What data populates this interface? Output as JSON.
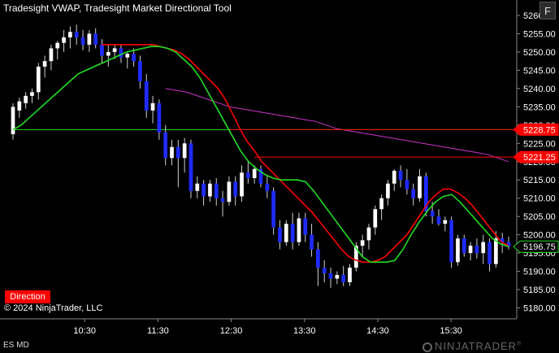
{
  "indicator_title": "Tradesight VWAP, Tradesight Market Directional Tool",
  "panel_button": "F",
  "direction_label": "Direction",
  "copyright": "© 2024 NinjaTrader, LLC",
  "instrument": "ES MD",
  "logo": "NINJATRADER",
  "logo_mark": "®",
  "colors": {
    "background": "#000000",
    "up_candle": "#ffffff",
    "down_candle": "#1f2bff",
    "red_line": "#ff0000",
    "green_line": "#22dd22",
    "vwap": "#cc33cc"
  },
  "chart_data": {
    "type": "candlestick",
    "title": "",
    "y_axis_ticks": [
      5260,
      5255,
      5250,
      5245,
      5240,
      5235,
      5230,
      5225,
      5220,
      5215,
      5210,
      5205,
      5200,
      5195,
      5190,
      5185,
      5180
    ],
    "y_axis_tick_labels": [
      "5260.00",
      "5255.00",
      "5250.00",
      "5245.00",
      "5240.00",
      "5235.00",
      "5230.00",
      "5225.00",
      "5220.00",
      "5215.00",
      "5210.00",
      "5205.00",
      "5200.00",
      "5195.00",
      "5190.00",
      "5185.00",
      "5180.00"
    ],
    "x_axis_ticks": [
      "10:30",
      "11:30",
      "12:30",
      "13:30",
      "14:30",
      "15:30"
    ],
    "ylim": [
      5177,
      5262
    ],
    "price_labels": [
      {
        "value": 5228.75,
        "label": "5228.75",
        "style": "red"
      },
      {
        "value": 5221.25,
        "label": "5221.25",
        "style": "red"
      },
      {
        "value": 5196.75,
        "label": "5196.75",
        "style": "green"
      }
    ],
    "horizontal_levels": [
      {
        "color": "#ff0000",
        "value": 5228.75
      },
      {
        "color": "#ff0000",
        "value": 5221.25
      },
      {
        "color": "#22dd22",
        "value": 5228.75
      }
    ],
    "candles": [
      {
        "o": 5227.5,
        "h": 5236.0,
        "l": 5226.0,
        "c": 5235.0
      },
      {
        "o": 5234.0,
        "h": 5237.5,
        "l": 5232.0,
        "c": 5236.5
      },
      {
        "o": 5236.0,
        "h": 5239.0,
        "l": 5234.5,
        "c": 5238.0
      },
      {
        "o": 5238.0,
        "h": 5240.0,
        "l": 5236.0,
        "c": 5239.0
      },
      {
        "o": 5239.0,
        "h": 5247.0,
        "l": 5237.0,
        "c": 5246.0
      },
      {
        "o": 5246.0,
        "h": 5249.0,
        "l": 5243.0,
        "c": 5247.5
      },
      {
        "o": 5247.5,
        "h": 5252.0,
        "l": 5245.0,
        "c": 5251.0
      },
      {
        "o": 5251.0,
        "h": 5253.0,
        "l": 5248.0,
        "c": 5252.5
      },
      {
        "o": 5252.5,
        "h": 5256.0,
        "l": 5250.0,
        "c": 5254.0
      },
      {
        "o": 5254.0,
        "h": 5257.0,
        "l": 5251.0,
        "c": 5255.5
      },
      {
        "o": 5255.5,
        "h": 5257.5,
        "l": 5252.0,
        "c": 5254.0
      },
      {
        "o": 5254.0,
        "h": 5256.0,
        "l": 5250.5,
        "c": 5252.0
      },
      {
        "o": 5252.0,
        "h": 5256.0,
        "l": 5250.0,
        "c": 5255.0
      },
      {
        "o": 5255.0,
        "h": 5256.5,
        "l": 5251.0,
        "c": 5252.0
      },
      {
        "o": 5252.0,
        "h": 5253.5,
        "l": 5247.0,
        "c": 5249.0
      },
      {
        "o": 5249.0,
        "h": 5252.0,
        "l": 5246.0,
        "c": 5250.0
      },
      {
        "o": 5250.0,
        "h": 5252.0,
        "l": 5248.0,
        "c": 5251.0
      },
      {
        "o": 5251.0,
        "h": 5252.0,
        "l": 5247.0,
        "c": 5248.5
      },
      {
        "o": 5248.5,
        "h": 5250.0,
        "l": 5245.5,
        "c": 5249.5
      },
      {
        "o": 5249.5,
        "h": 5251.0,
        "l": 5246.0,
        "c": 5247.5
      },
      {
        "o": 5247.5,
        "h": 5249.0,
        "l": 5240.0,
        "c": 5242.0
      },
      {
        "o": 5242.0,
        "h": 5244.0,
        "l": 5232.0,
        "c": 5234.0
      },
      {
        "o": 5234.0,
        "h": 5238.0,
        "l": 5230.5,
        "c": 5236.0
      },
      {
        "o": 5236.0,
        "h": 5237.0,
        "l": 5226.0,
        "c": 5228.0
      },
      {
        "o": 5228.0,
        "h": 5230.0,
        "l": 5219.0,
        "c": 5221.0
      },
      {
        "o": 5221.0,
        "h": 5226.0,
        "l": 5219.0,
        "c": 5224.0
      },
      {
        "o": 5224.0,
        "h": 5226.0,
        "l": 5213.0,
        "c": 5221.0
      },
      {
        "o": 5221.0,
        "h": 5226.5,
        "l": 5217.0,
        "c": 5225.0
      },
      {
        "o": 5225.0,
        "h": 5226.0,
        "l": 5210.0,
        "c": 5212.0
      },
      {
        "o": 5212.0,
        "h": 5216.0,
        "l": 5210.0,
        "c": 5214.0
      },
      {
        "o": 5214.0,
        "h": 5215.0,
        "l": 5208.0,
        "c": 5210.5
      },
      {
        "o": 5210.5,
        "h": 5215.0,
        "l": 5209.0,
        "c": 5214.0
      },
      {
        "o": 5214.0,
        "h": 5215.5,
        "l": 5208.0,
        "c": 5210.0
      },
      {
        "o": 5210.0,
        "h": 5212.0,
        "l": 5205.0,
        "c": 5209.0
      },
      {
        "o": 5209.0,
        "h": 5216.0,
        "l": 5208.0,
        "c": 5214.5
      },
      {
        "o": 5214.5,
        "h": 5216.0,
        "l": 5208.0,
        "c": 5210.5
      },
      {
        "o": 5210.5,
        "h": 5219.0,
        "l": 5209.0,
        "c": 5217.0
      },
      {
        "o": 5217.0,
        "h": 5220.0,
        "l": 5214.0,
        "c": 5215.5
      },
      {
        "o": 5215.5,
        "h": 5219.0,
        "l": 5214.0,
        "c": 5218.0
      },
      {
        "o": 5218.0,
        "h": 5219.0,
        "l": 5213.0,
        "c": 5214.0
      },
      {
        "o": 5214.0,
        "h": 5216.0,
        "l": 5210.0,
        "c": 5212.0
      },
      {
        "o": 5212.0,
        "h": 5213.0,
        "l": 5200.0,
        "c": 5202.0
      },
      {
        "o": 5202.0,
        "h": 5204.0,
        "l": 5196.0,
        "c": 5198.0
      },
      {
        "o": 5198.0,
        "h": 5204.0,
        "l": 5197.0,
        "c": 5203.0
      },
      {
        "o": 5203.0,
        "h": 5206.0,
        "l": 5196.0,
        "c": 5198.0
      },
      {
        "o": 5198.0,
        "h": 5206.0,
        "l": 5197.0,
        "c": 5204.5
      },
      {
        "o": 5204.5,
        "h": 5206.0,
        "l": 5198.0,
        "c": 5200.0
      },
      {
        "o": 5200.0,
        "h": 5203.0,
        "l": 5194.0,
        "c": 5196.0
      },
      {
        "o": 5196.0,
        "h": 5198.0,
        "l": 5186.0,
        "c": 5191.0
      },
      {
        "o": 5191.0,
        "h": 5193.0,
        "l": 5187.0,
        "c": 5189.5
      },
      {
        "o": 5189.5,
        "h": 5191.0,
        "l": 5185.5,
        "c": 5188.0
      },
      {
        "o": 5188.0,
        "h": 5190.0,
        "l": 5186.5,
        "c": 5189.0
      },
      {
        "o": 5189.0,
        "h": 5191.5,
        "l": 5186.0,
        "c": 5187.0
      },
      {
        "o": 5187.0,
        "h": 5192.0,
        "l": 5186.0,
        "c": 5191.0
      },
      {
        "o": 5191.0,
        "h": 5198.0,
        "l": 5190.0,
        "c": 5197.0
      },
      {
        "o": 5197.0,
        "h": 5200.0,
        "l": 5194.0,
        "c": 5198.5
      },
      {
        "o": 5198.5,
        "h": 5203.0,
        "l": 5196.0,
        "c": 5202.0
      },
      {
        "o": 5202.0,
        "h": 5208.0,
        "l": 5200.0,
        "c": 5207.0
      },
      {
        "o": 5207.0,
        "h": 5211.0,
        "l": 5204.0,
        "c": 5210.0
      },
      {
        "o": 5210.0,
        "h": 5215.0,
        "l": 5208.0,
        "c": 5214.0
      },
      {
        "o": 5214.0,
        "h": 5218.0,
        "l": 5212.0,
        "c": 5217.5
      },
      {
        "o": 5217.5,
        "h": 5219.0,
        "l": 5213.0,
        "c": 5215.0
      },
      {
        "o": 5215.0,
        "h": 5218.0,
        "l": 5211.0,
        "c": 5212.5
      },
      {
        "o": 5212.5,
        "h": 5214.0,
        "l": 5208.0,
        "c": 5210.0
      },
      {
        "o": 5210.0,
        "h": 5218.0,
        "l": 5209.0,
        "c": 5216.0
      },
      {
        "o": 5216.0,
        "h": 5217.0,
        "l": 5205.0,
        "c": 5206.5
      },
      {
        "o": 5206.5,
        "h": 5209.0,
        "l": 5203.0,
        "c": 5205.0
      },
      {
        "o": 5205.0,
        "h": 5207.0,
        "l": 5202.5,
        "c": 5203.0
      },
      {
        "o": 5203.0,
        "h": 5205.0,
        "l": 5201.0,
        "c": 5204.0
      },
      {
        "o": 5204.0,
        "h": 5205.0,
        "l": 5191.0,
        "c": 5192.5
      },
      {
        "o": 5192.5,
        "h": 5200.0,
        "l": 5191.5,
        "c": 5199.0
      },
      {
        "o": 5199.0,
        "h": 5200.0,
        "l": 5194.0,
        "c": 5195.0
      },
      {
        "o": 5195.0,
        "h": 5198.0,
        "l": 5193.0,
        "c": 5197.0
      },
      {
        "o": 5197.0,
        "h": 5199.0,
        "l": 5193.5,
        "c": 5195.0
      },
      {
        "o": 5195.0,
        "h": 5200.0,
        "l": 5192.0,
        "c": 5198.0
      },
      {
        "o": 5198.0,
        "h": 5199.0,
        "l": 5190.0,
        "c": 5192.0
      },
      {
        "o": 5192.0,
        "h": 5201.0,
        "l": 5191.0,
        "c": 5199.0
      },
      {
        "o": 5199.0,
        "h": 5200.5,
        "l": 5195.0,
        "c": 5198.0
      },
      {
        "o": 5198.0,
        "h": 5199.5,
        "l": 5196.0,
        "c": 5196.75
      }
    ],
    "red_line": [
      5252,
      5252,
      5252,
      5252,
      5252,
      5252,
      5252,
      5252,
      5251.5,
      5251,
      5250.5,
      5249.5,
      5248,
      5246,
      5244,
      5242,
      5240,
      5237,
      5233,
      5229,
      5225.5,
      5223,
      5220,
      5218,
      5216,
      5214,
      5212,
      5210,
      5208,
      5206,
      5203.5,
      5201,
      5198.5,
      5196,
      5194,
      5193,
      5192.5,
      5192.5,
      5193,
      5194,
      5196,
      5198,
      5200,
      5203,
      5206,
      5209,
      5211,
      5212.5,
      5212.5,
      5211.5,
      5210,
      5208,
      5205.5,
      5203,
      5200.5,
      5198,
      5197
    ],
    "green_line": [
      5228.75,
      5230,
      5232,
      5234,
      5236,
      5238,
      5240,
      5242,
      5244,
      5245,
      5246,
      5247,
      5248,
      5249,
      5250,
      5250.5,
      5251,
      5251.5,
      5251.5,
      5251,
      5250,
      5248,
      5246,
      5243,
      5239,
      5235,
      5231,
      5227,
      5223,
      5220,
      5218,
      5216.5,
      5215.5,
      5215,
      5215,
      5215,
      5214.5,
      5212,
      5209,
      5206,
      5203,
      5200,
      5197,
      5194,
      5192.5,
      5192.5,
      5192.5,
      5193,
      5196,
      5200,
      5203.5,
      5206.5,
      5209,
      5210.5,
      5211,
      5209,
      5206.5,
      5204,
      5201.5,
      5199,
      5197.5,
      5196.75
    ],
    "vwap_line": [
      5240,
      5239.5,
      5239,
      5238,
      5237,
      5236,
      5235,
      5234.5,
      5234,
      5233.5,
      5233,
      5232.5,
      5232,
      5231.5,
      5231,
      5230,
      5229,
      5228.5,
      5228,
      5227.5,
      5227,
      5226.5,
      5226,
      5225.5,
      5225,
      5224.5,
      5224,
      5223.5,
      5223,
      5222.5,
      5222,
      5221,
      5220
    ]
  }
}
